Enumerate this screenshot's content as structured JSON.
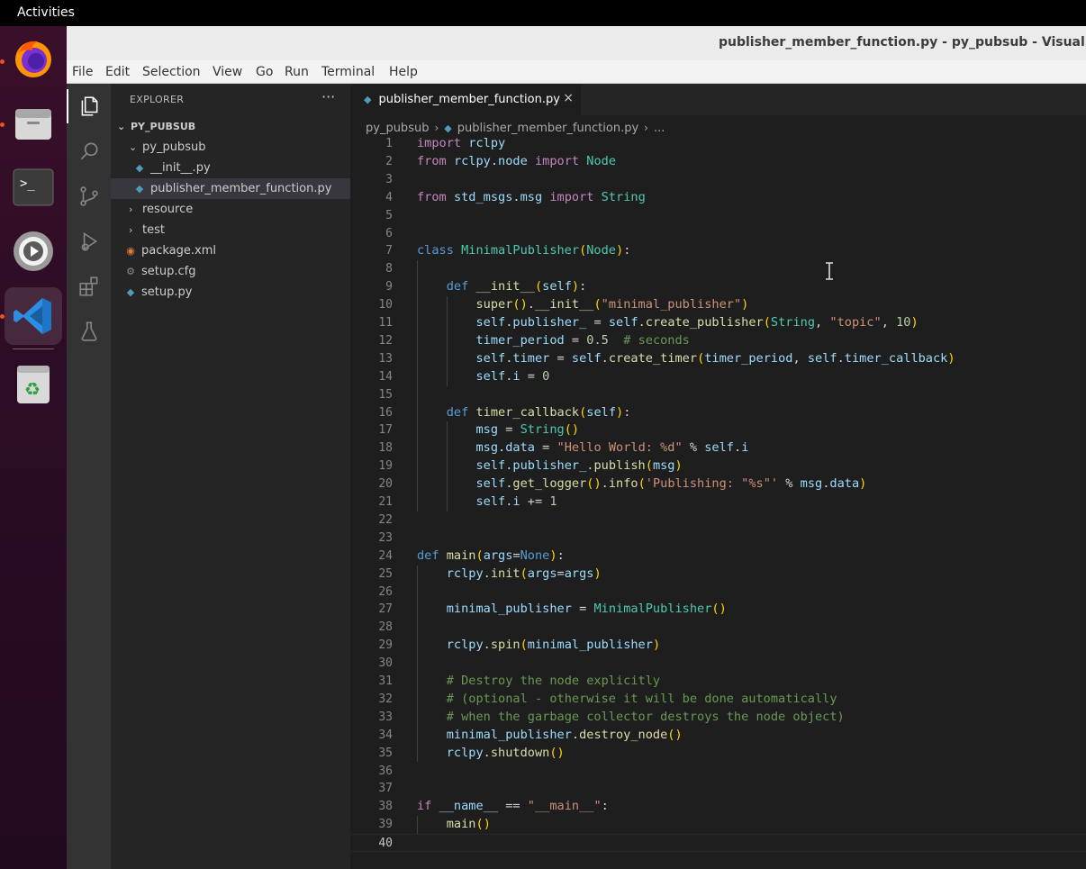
{
  "topbar": {
    "activities": "Activities"
  },
  "dock": {
    "items": [
      {
        "name": "firefox-icon",
        "running": true
      },
      {
        "name": "files-icon",
        "running": true
      },
      {
        "name": "terminal-icon",
        "running": false
      },
      {
        "name": "settings-icon",
        "running": false
      },
      {
        "name": "vscode-icon",
        "running": true,
        "active": true
      },
      {
        "name": "trash-icon",
        "running": false
      }
    ]
  },
  "window": {
    "title": "publisher_member_function.py - py_pubsub - Visual Stu",
    "menu": [
      "File",
      "Edit",
      "Selection",
      "View",
      "Go",
      "Run",
      "Terminal",
      "Help"
    ]
  },
  "activitybar": {
    "icons": [
      "explorer-icon",
      "search-icon",
      "source-control-icon",
      "run-debug-icon",
      "extensions-icon",
      "testing-icon"
    ]
  },
  "explorer": {
    "header": "EXPLORER",
    "more": "···",
    "project": "PY_PUBSUB",
    "tree": [
      {
        "label": "py_pubsub",
        "type": "folder",
        "open": true
      },
      {
        "label": "__init__.py",
        "type": "py"
      },
      {
        "label": "publisher_member_function.py",
        "type": "py",
        "selected": true
      },
      {
        "label": "resource",
        "type": "folder",
        "open": false
      },
      {
        "label": "test",
        "type": "folder",
        "open": false
      },
      {
        "label": "package.xml",
        "type": "xml"
      },
      {
        "label": "setup.cfg",
        "type": "cfg"
      },
      {
        "label": "setup.py",
        "type": "py"
      }
    ]
  },
  "editor": {
    "tab": {
      "label": "publisher_member_function.py",
      "close": "×"
    },
    "breadcrumb": {
      "folder": "py_pubsub",
      "file": "publisher_member_function.py",
      "more": "..."
    },
    "line_numbers": [
      "1",
      "2",
      "3",
      "4",
      "5",
      "6",
      "7",
      "8",
      "9",
      "10",
      "11",
      "12",
      "13",
      "14",
      "15",
      "16",
      "17",
      "18",
      "19",
      "20",
      "21",
      "22",
      "23",
      "24",
      "25",
      "26",
      "27",
      "28",
      "29",
      "30",
      "31",
      "32",
      "33",
      "34",
      "35",
      "36",
      "37",
      "38",
      "39",
      "40"
    ],
    "lines": [
      "import rclpy",
      "from rclpy.node import Node",
      "",
      "from std_msgs.msg import String",
      "",
      "",
      "class MinimalPublisher(Node):",
      "",
      "    def __init__(self):",
      "        super().__init__(\"minimal_publisher\")",
      "        self.publisher_ = self.create_publisher(String, \"topic\", 10)",
      "        timer_period = 0.5  # seconds",
      "        self.timer = self.create_timer(timer_period, self.timer_callback)",
      "        self.i = 0",
      "",
      "    def timer_callback(self):",
      "        msg = String()",
      "        msg.data = \"Hello World: %d\" % self.i",
      "        self.publisher_.publish(msg)",
      "        self.get_logger().info('Publishing: \"%s\"' % msg.data)",
      "        self.i += 1",
      "",
      "",
      "def main(args=None):",
      "    rclpy.init(args=args)",
      "",
      "    minimal_publisher = MinimalPublisher()",
      "",
      "    rclpy.spin(minimal_publisher)",
      "",
      "    # Destroy the node explicitly",
      "    # (optional - otherwise it will be done automatically",
      "    # when the garbage collector destroys the node object)",
      "    minimal_publisher.destroy_node()",
      "    rclpy.shutdown()",
      "",
      "",
      "if __name__ == \"__main__\":",
      "    main()",
      ""
    ],
    "current_line": "40"
  },
  "colors": {
    "keyword": "#c586c0",
    "class": "#4ec9b0",
    "function": "#dcdcaa",
    "string": "#ce9178",
    "number": "#b5cea8",
    "comment": "#6a9955",
    "variable": "#9cdcfe"
  }
}
